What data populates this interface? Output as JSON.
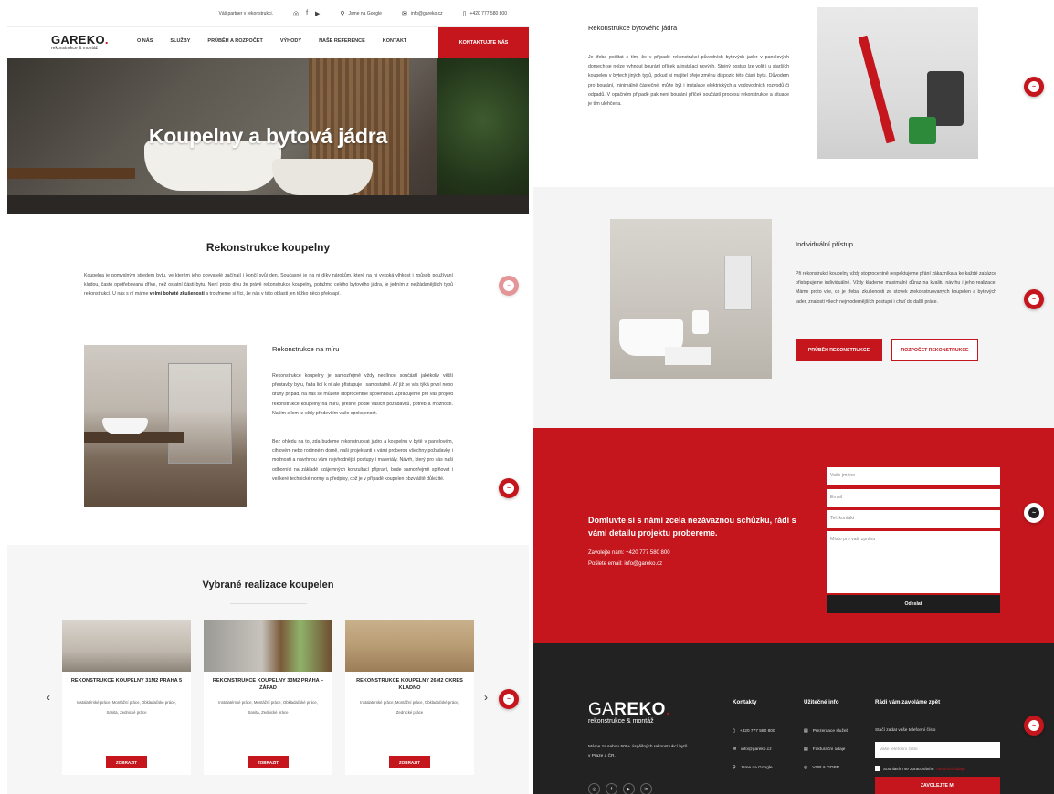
{
  "topbar": {
    "partner": "Váš partner v rekonstrukci.",
    "google": "Jsme na Google",
    "email": "info@gareko.cz",
    "phone": "+420 777 580 800"
  },
  "logo": {
    "name_prefix": "GA",
    "name_main": "REKO",
    "name_dot": ".",
    "tagline": "rekonstrukce & montáž"
  },
  "nav": {
    "items": [
      "O NÁS",
      "SLUŽBY",
      "PRŮBĚH A ROZPOČET",
      "VÝHODY",
      "NAŠE REFERENCE",
      "KONTAKT"
    ],
    "cta": "KONTAKTUJTE NÁS"
  },
  "hero": {
    "title": "Koupelny a bytová jádra"
  },
  "rekonstrukce": {
    "title": "Rekonstrukce koupelny",
    "text_before": "Koupelna je pomyslným středem bytu, ve kterém jeho obyvatelé začínají i končí svůj den. Současně je na ni díky nárokům, které na ni vysoká vlhkost i způsob používání kladou, často opotřebovaná dříve, než ostatní části bytu. Není proto divu že právě rekonstrukce koupelny, potažmo celého bytového jádra, je jedním z nejžádanějších typů rekonstrukcí. U nás s ní máme ",
    "text_bold": "velmi bohaté zkušenosti",
    "text_after": " a troufneme si říci, že nás v této oblasti jen těžko něco překvapí."
  },
  "miru": {
    "title": "Rekonstrukce na míru",
    "p1": "Rekonstrukce koupelny je samozřejmě vždy nedílnou součástí jakékoliv větší přestavby bytu, řada lidí k ní ale přistupuje i samostatně. Ať již se vás týká první nebo druhý případ, na nás se můžete stoprocentně spolehnout. Zpracujeme pro vás projekt rekonstrukce koupelny na míru, přesně podle vašich požadavků, potřeb a možností. Naším cílem je vždy především vaše spokojenost.",
    "p2": "Bez ohledu na to, zda budeme rekonstruovat jádro a koupelnu v bytě v panelovém, cihlovém nebo rodinném domě, naši projektanti s vámi proberou všechny požadavky i možnosti a navrhnou vám nejvhodnější postupy i materiály. Návrh, který pro vás naši odborníci na základě vzájemných konzultací připraví, bude samozřejmě splňovat i veškeré technické normy a předpisy, což je v případě koupelen obzvláště důležité."
  },
  "references": {
    "title": "Vybrané realizace koupelen",
    "cards": [
      {
        "title": "REKONSTRUKCE KOUPELNY 31M2 PRAHA 5",
        "tags1": "Instalatérské práce, Montážní práce, Obkladačské práce,",
        "tags2": "Sanita, Zednické práce",
        "button": "ZOBRAZIT"
      },
      {
        "title": "REKONSTRUKCE KOUPELNY 33M2 PRAHA – ZÁPAD",
        "tags1": "Instalatérské práce, Montážní práce, Obkladačské práce,",
        "tags2": "Sanita, Zednické práce",
        "button": "ZOBRAZIT"
      },
      {
        "title": "REKONSTRUKCE KOUPELNY 26M2 OKRES KLADNO",
        "tags1": "Instalatérské práce, Montážní práce, Obkladačské práce,",
        "tags2": "Zednické práce",
        "button": "ZOBRAZIT"
      }
    ],
    "prev": "‹",
    "next": "›"
  },
  "jadro": {
    "title": "Rekonstrukce bytového jádra",
    "text": "Je třeba počítat s tím, že v případě rekonstrukcí původních bytových jader v panelových domech se nelze vyhnout bourání příček a instalaci nových. Stejný postup lze volit i u starších koupelen v bytech jiných typů, pokud si majitel přeje změnu dispozic této části bytu. Důvodem pro bourání, minimálně částečné, může být i instalace elektrických a vodovodních rozvodů či odpadů. V opačném případě pak není bourání příček součástí procesu rekonstrukce a situace je tím ulehčena."
  },
  "indiv": {
    "title": "Individuální přístup",
    "text": "Při rekonstrukci koupelny vždy stoprocentně respektujeme přání zákazníka a ke každé zakázce přistupujeme individuálně. Vždy klademe maximální důraz na kvalitu návrhu i jeho realizace. Máme proto vše, co je třeba: zkušenosti ze stovek zrekonstruovaných koupelen a bytových jader, znalosti všech nejmodernějších postupů i chuť do další práce.",
    "btn_process": "PRŮBĚH REKONSTRUKCE",
    "btn_budget": "ROZPOČET REKONSTRUKCE"
  },
  "contact_form": {
    "lead": "Domluvte si s námi zcela nezávaznou schůzku, rádi s vámi detailu projektu probereme.",
    "call": "Zavolejte nám: +420 777 580 800",
    "mail": "Pošlete email: info@gareko.cz",
    "name_ph": "Vaše jméno",
    "email_ph": "Email",
    "phone_ph": "Tel. kontakt",
    "msg_ph": "Místo pro vaši zprávu",
    "submit": "Odeslat"
  },
  "footer": {
    "logo_prefix": "GA",
    "logo_main": "REKO",
    "logo_dot": ".",
    "tagline": "rekonstrukce & montáž",
    "about": "Máme za sebou 500+ úspěšných rekonstrukcí bytů v Praze a ČR.",
    "contacts_title": "Kontakty",
    "phone": "+420 777 580 800",
    "email": "info@gareko.cz",
    "google": "Jsme na Google",
    "useful_title": "Užitečné info",
    "presentation": "Prezentace služeb",
    "billing": "Fakturační údaje",
    "terms": "VOP & GDPR",
    "callback_title": "Rádi vám zavoláme zpět",
    "callback_note": "Stačí zadat vaše telefonní číslo",
    "phone_ph": "Vaše telefonní číslo",
    "consent": "Souhlasím se zpracováním",
    "consent_link": "osobních údajů",
    "submit": "ZAVOLEJTE MI"
  },
  "colors": {
    "brand": "#c4161c",
    "dark": "#222222",
    "light_bg": "#f6f6f6"
  }
}
